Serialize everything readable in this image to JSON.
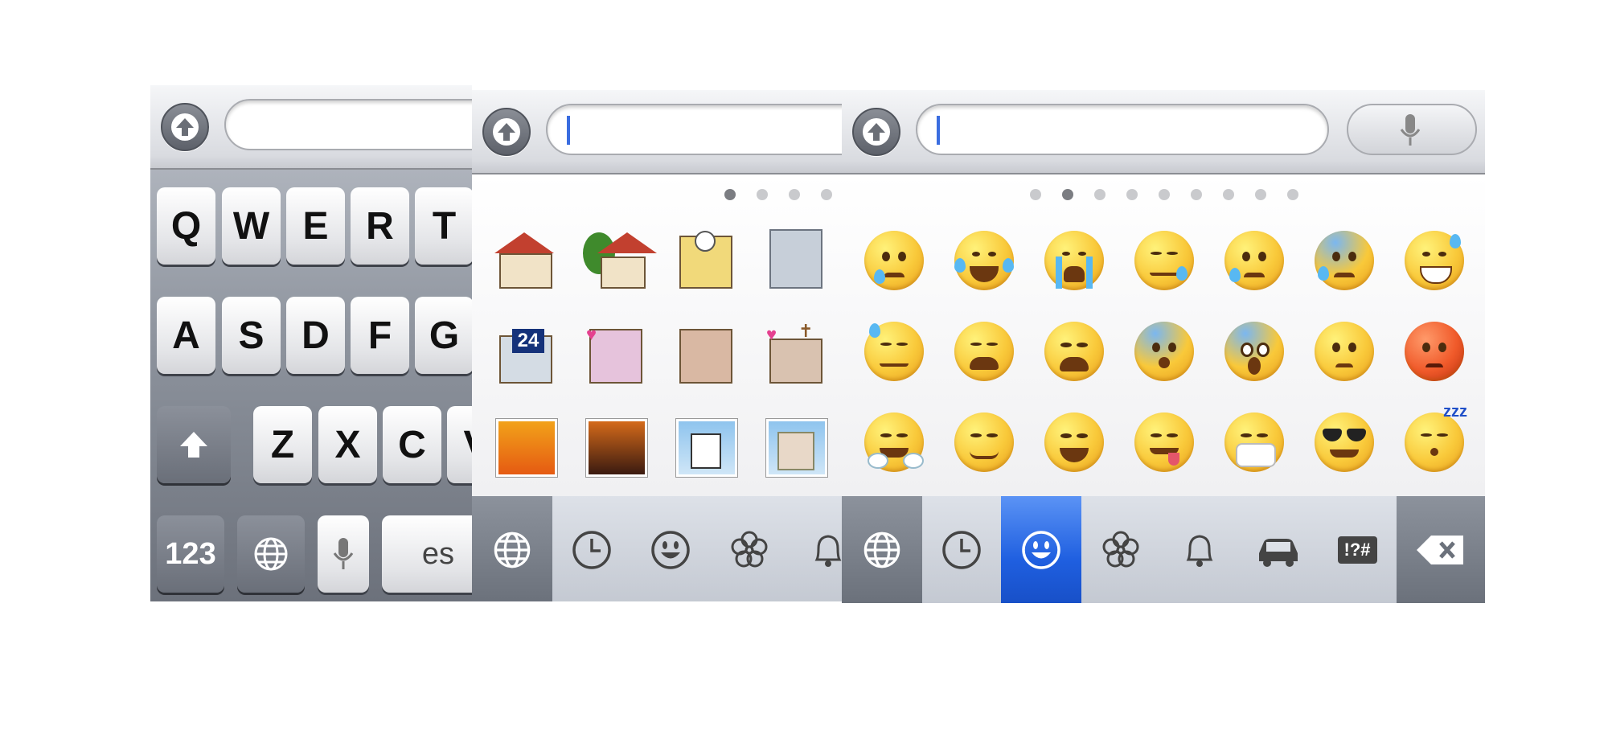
{
  "keyboard_qwerty": {
    "row1": [
      "Q",
      "W",
      "E",
      "R",
      "T"
    ],
    "row2": [
      "A",
      "S",
      "D",
      "F",
      "G"
    ],
    "row3": [
      "Z",
      "X",
      "C",
      "V"
    ],
    "numbers_key": "123",
    "space_partial": "es",
    "icons": [
      "shift-up-arrow-icon",
      "globe-icon",
      "microphone-icon"
    ]
  },
  "emoji_places": {
    "page_dots": 4,
    "active_dot": 0,
    "icons": [
      "house-icon",
      "house-with-tree-icon",
      "school-clock-icon",
      "office-building-icon",
      "convenience-store-24-icon",
      "love-hotel-icon",
      "hotel-icon",
      "wedding-chapel-icon",
      "sunset-over-city-icon",
      "night-city-icon",
      "japanese-castle-icon",
      "european-castle-icon"
    ],
    "store_label": "24"
  },
  "emoji_faces": {
    "page_dots": 9,
    "active_dot": 1,
    "icons": [
      "crying-face-icon",
      "tears-of-joy-face-icon",
      "loudly-crying-face-icon",
      "sleepy-face-icon",
      "disappointed-relieved-face-icon",
      "anxious-sweat-face-icon",
      "grinning-sweat-face-icon",
      "downcast-sweat-face-icon",
      "weary-face-icon",
      "tired-face-icon",
      "fearful-face-icon",
      "screaming-fear-face-icon",
      "angry-face-icon",
      "pouting-red-face-icon",
      "triumph-face-icon",
      "confounded-face-icon",
      "laughing-face-icon",
      "yum-face-icon",
      "mask-face-icon",
      "sunglasses-face-icon",
      "sleeping-face-icon"
    ],
    "sleep_label": "zzz"
  },
  "category_tabs": {
    "places_panel": [
      "globe-icon",
      "clock-icon",
      "smiley-icon",
      "flower-icon",
      "bell-icon"
    ],
    "faces_panel": [
      "globe-icon",
      "clock-icon",
      "smiley-icon",
      "flower-icon",
      "bell-icon",
      "car-icon",
      "symbols-icon",
      "backspace-icon"
    ],
    "symbols_label": "!?#",
    "active_tab": "smiley-icon"
  },
  "colors": {
    "active_tab_blue": "#1f5fe0",
    "caret_blue": "#3a6de0",
    "key_white": "#ffffff",
    "keyboard_gray": "#8d939d"
  }
}
